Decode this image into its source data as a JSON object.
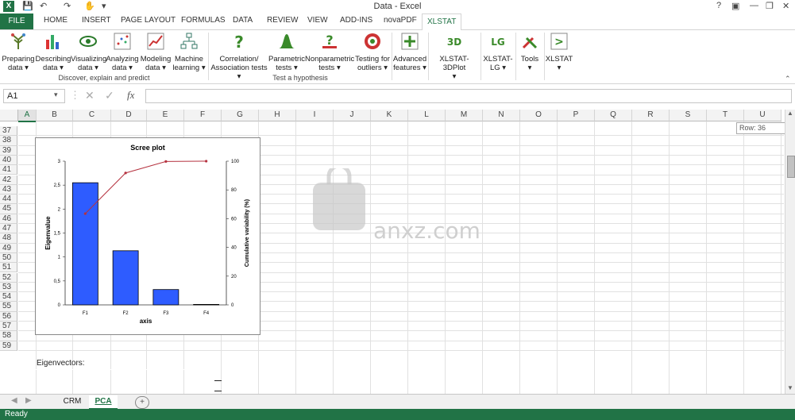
{
  "window": {
    "title": "Data - Excel",
    "help": "?",
    "minimize": "—",
    "restore": "❐",
    "close": "✕",
    "ribbon_opts": "▣"
  },
  "tabs": [
    "FILE",
    "HOME",
    "INSERT",
    "PAGE LAYOUT",
    "FORMULAS",
    "DATA",
    "REVIEW",
    "VIEW",
    "ADD-INS",
    "novaPDF",
    "XLSTAT"
  ],
  "ribbon": {
    "buttons": [
      {
        "l1": "Preparing",
        "l2": "data ▾"
      },
      {
        "l1": "Describing",
        "l2": "data ▾"
      },
      {
        "l1": "Visualizing",
        "l2": "data ▾"
      },
      {
        "l1": "Analyzing",
        "l2": "data ▾"
      },
      {
        "l1": "Modeling",
        "l2": "data ▾"
      },
      {
        "l1": "Machine",
        "l2": "learning ▾"
      },
      {
        "l1": "Correlation/",
        "l2": "Association tests ▾"
      },
      {
        "l1": "Parametric",
        "l2": "tests ▾"
      },
      {
        "l1": "Nonparametric",
        "l2": "tests ▾"
      },
      {
        "l1": "Testing for",
        "l2": "outliers ▾"
      },
      {
        "l1": "Advanced",
        "l2": "features ▾"
      },
      {
        "l1": "XLSTAT-3DPlot",
        "l2": "▾"
      },
      {
        "l1": "XLSTAT-",
        "l2": "LG ▾"
      },
      {
        "l1": "Tools",
        "l2": "▾"
      },
      {
        "l1": "XLSTAT",
        "l2": "▾"
      }
    ],
    "groups": [
      "Discover, explain and predict",
      "Test a hypothesis"
    ],
    "icon_text": {
      "3d": "3D",
      "lg": "LG",
      "xl": ">"
    }
  },
  "formula_bar": {
    "cell_ref": "A1",
    "value": "",
    "fx": "fx"
  },
  "columns": [
    "A",
    "B",
    "C",
    "D",
    "E",
    "F",
    "G",
    "H",
    "I",
    "J",
    "K",
    "L",
    "M",
    "N",
    "O",
    "P",
    "Q",
    "R",
    "S",
    "T",
    "U"
  ],
  "rows": [
    "37",
    "38",
    "39",
    "40",
    "41",
    "42",
    "43",
    "44",
    "45",
    "46",
    "47",
    "48",
    "49",
    "50",
    "51",
    "52",
    "53",
    "54",
    "55",
    "56",
    "57",
    "58",
    "59"
  ],
  "row_tooltip": "Row: 36",
  "cell_text": {
    "eigenvectors": "Eigenvectors:"
  },
  "sheets": [
    "CRM",
    "PCA"
  ],
  "add_sheet": "+",
  "status": "Ready",
  "watermark": "anxz.com",
  "chart_data": {
    "type": "bar",
    "title": "Scree plot",
    "xlabel": "axis",
    "ylabel": "Eigenvalue",
    "y2label": "Cumulative variability (%)",
    "categories": [
      "F1",
      "F2",
      "F3",
      "F4"
    ],
    "series": [
      {
        "values": [
          2.55,
          1.13,
          0.32,
          0.01
        ]
      },
      {
        "values": [
          63.5,
          91.8,
          99.8,
          100
        ]
      }
    ],
    "ylim": [
      0,
      3
    ],
    "y2lim": [
      0,
      100
    ],
    "yticks": [
      "0",
      "0,5",
      "1",
      "1,5",
      "2",
      "2,5",
      "3"
    ],
    "y2ticks": [
      "0",
      "20",
      "40",
      "60",
      "80",
      "100"
    ],
    "colors": {
      "bars": "#2e5cff",
      "line": "#b5323f"
    }
  }
}
